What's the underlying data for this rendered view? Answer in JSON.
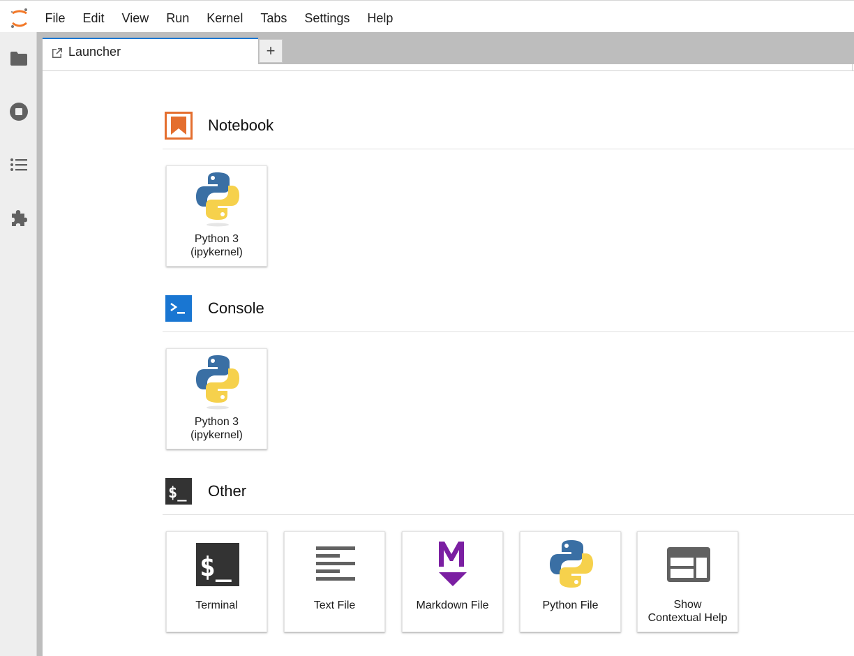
{
  "menubar": {
    "items": [
      "File",
      "Edit",
      "View",
      "Run",
      "Kernel",
      "Tabs",
      "Settings",
      "Help"
    ]
  },
  "sidebar": {
    "icons": [
      "folder-icon",
      "running-sessions-icon",
      "table-of-contents-icon",
      "extension-icon"
    ]
  },
  "tabs": {
    "active_label": "Launcher",
    "add_label": "+"
  },
  "launcher": {
    "notebook": {
      "title": "Notebook",
      "cards": [
        {
          "line1": "Python 3",
          "line2": "(ipykernel)"
        }
      ]
    },
    "console": {
      "title": "Console",
      "cards": [
        {
          "line1": "Python 3",
          "line2": "(ipykernel)"
        }
      ]
    },
    "other": {
      "title": "Other",
      "cards": [
        {
          "line1": "Terminal"
        },
        {
          "line1": "Text File"
        },
        {
          "line1": "Markdown File"
        },
        {
          "line1": "Python File"
        },
        {
          "line1": "Show",
          "line2": "Contextual Help"
        }
      ]
    }
  },
  "colors": {
    "accent": "#1976d2",
    "notebook_orange": "#e46e2e",
    "console_blue": "#1976d2",
    "terminal_dark": "#333333",
    "markdown_purple": "#7b1fa2",
    "python_blue": "#3a6fa4",
    "python_yellow": "#f6d14c"
  }
}
